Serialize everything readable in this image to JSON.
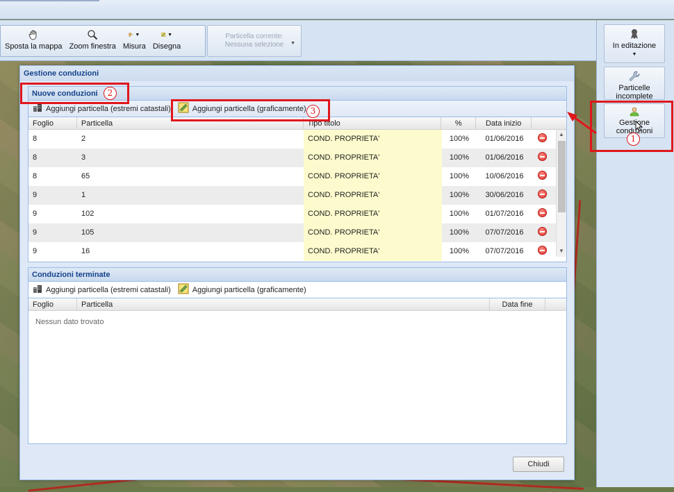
{
  "toolbar": {
    "pan_label": "Sposta la mappa",
    "zoom_label": "Zoom finestra",
    "measure_label": "Misura",
    "draw_label": "Disegna",
    "current_parcel_title": "Particella corrente:",
    "current_parcel_value": "Nessuna selezione"
  },
  "right_panel": {
    "editing_label": "In editazione",
    "incomplete_label_1": "Particelle",
    "incomplete_label_2": "incomplete",
    "management_label_1": "Gestione",
    "management_label_2": "conduzioni"
  },
  "dialog": {
    "title": "Gestione conduzioni",
    "close_label": "Chiudi"
  },
  "new_panel": {
    "title": "Nuove conduzioni",
    "add_cadastral_label": "Aggiungi particella (estremi catastali)",
    "add_graphic_label": "Aggiungi particella (graficamente)",
    "columns": [
      "Foglio",
      "Particella",
      "Tipo titolo",
      "%",
      "Data inizio"
    ],
    "rows": [
      {
        "foglio": "8",
        "particella": "2",
        "tipo": "COND. PROPRIETA'",
        "perc": "100%",
        "data": "01/06/2016"
      },
      {
        "foglio": "8",
        "particella": "3",
        "tipo": "COND. PROPRIETA'",
        "perc": "100%",
        "data": "01/06/2016"
      },
      {
        "foglio": "8",
        "particella": "65",
        "tipo": "COND. PROPRIETA'",
        "perc": "100%",
        "data": "10/06/2016"
      },
      {
        "foglio": "9",
        "particella": "1",
        "tipo": "COND. PROPRIETA'",
        "perc": "100%",
        "data": "30/06/2016"
      },
      {
        "foglio": "9",
        "particella": "102",
        "tipo": "COND. PROPRIETA'",
        "perc": "100%",
        "data": "01/07/2016"
      },
      {
        "foglio": "9",
        "particella": "105",
        "tipo": "COND. PROPRIETA'",
        "perc": "100%",
        "data": "07/07/2016"
      },
      {
        "foglio": "9",
        "particella": "16",
        "tipo": "COND. PROPRIETA'",
        "perc": "100%",
        "data": "07/07/2016"
      }
    ]
  },
  "ended_panel": {
    "title": "Conduzioni terminate",
    "add_cadastral_label": "Aggiungi particella (estremi catastali)",
    "add_graphic_label": "Aggiungi particella (graficamente)",
    "columns": [
      "Foglio",
      "Particella",
      "Data fine"
    ],
    "empty_text": "Nessun dato trovato"
  },
  "annotations": {
    "badge_1": "1",
    "badge_2": "2",
    "badge_3": "3",
    "highlight_color": "#e0161b"
  }
}
